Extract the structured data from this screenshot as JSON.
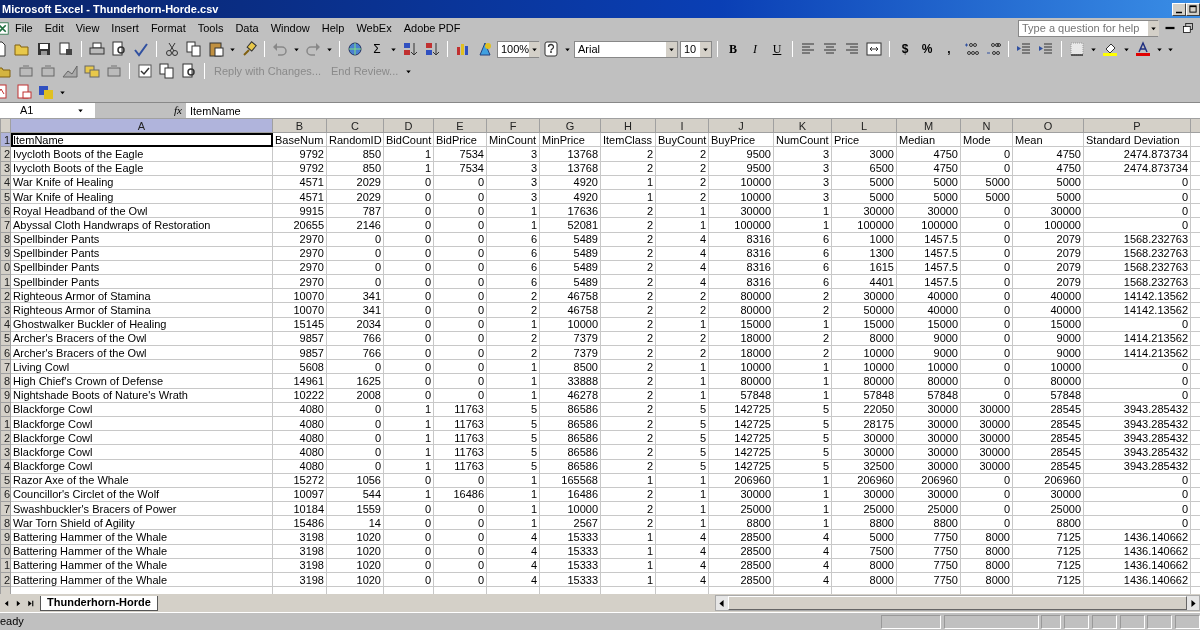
{
  "window": {
    "title": "Microsoft Excel - Thunderhorn-Horde.csv"
  },
  "menu": [
    {
      "label": "File"
    },
    {
      "label": "Edit"
    },
    {
      "label": "View"
    },
    {
      "label": "Insert"
    },
    {
      "label": "Format"
    },
    {
      "label": "Tools"
    },
    {
      "label": "Data"
    },
    {
      "label": "Window"
    },
    {
      "label": "Help"
    },
    {
      "label": "WebEx"
    },
    {
      "label": "Adobe PDF"
    }
  ],
  "help_box": {
    "placeholder": "Type a question for help"
  },
  "toolbar": {
    "sum": "Σ",
    "zoom": "100%",
    "font": "Arial",
    "font_size": "10",
    "format_buttons": [
      "B",
      "I",
      "U"
    ],
    "number_buttons": [
      "$",
      "%",
      ","
    ]
  },
  "review_toolbar": {
    "reply": "Reply with Changes...",
    "end": "End Review..."
  },
  "formula_bar": {
    "name_box": "A1",
    "fx": "fx",
    "formula": "ItemName"
  },
  "columns": [
    {
      "label": "A",
      "selected": true
    },
    {
      "label": "B",
      "selected": false
    },
    {
      "label": "C",
      "selected": false
    },
    {
      "label": "D",
      "selected": false
    },
    {
      "label": "E",
      "selected": false
    },
    {
      "label": "F",
      "selected": false
    },
    {
      "label": "G",
      "selected": false
    },
    {
      "label": "H",
      "selected": false
    },
    {
      "label": "I",
      "selected": false
    },
    {
      "label": "J",
      "selected": false
    },
    {
      "label": "K",
      "selected": false
    },
    {
      "label": "L",
      "selected": false
    },
    {
      "label": "M",
      "selected": false
    },
    {
      "label": "N",
      "selected": false
    },
    {
      "label": "O",
      "selected": false
    },
    {
      "label": "P",
      "selected": false
    }
  ],
  "rows": [
    {
      "header": "1",
      "kind": "labels",
      "selected": true,
      "cells": [
        "ItemName",
        "BaseNum",
        "RandomID",
        "BidCount",
        "BidPrice",
        "MinCount",
        "MinPrice",
        "ItemClass",
        "BuyCount",
        "BuyPrice",
        "NumCount",
        "Price",
        "Median",
        "Mode",
        "Mean",
        "Standard Deviation"
      ]
    },
    {
      "header": "2",
      "kind": "values",
      "selected": false,
      "cells": [
        "Ivycloth Boots of the Eagle",
        "9792",
        "850",
        "1",
        "7534",
        "3",
        "13768",
        "2",
        "2",
        "9500",
        "3",
        "3000",
        "4750",
        "0",
        "4750",
        "2474.873734"
      ]
    },
    {
      "header": "3",
      "kind": "values",
      "selected": false,
      "cells": [
        "Ivycloth Boots of the Eagle",
        "9792",
        "850",
        "1",
        "7534",
        "3",
        "13768",
        "2",
        "2",
        "9500",
        "3",
        "6500",
        "4750",
        "0",
        "4750",
        "2474.873734"
      ]
    },
    {
      "header": "4",
      "kind": "values",
      "selected": false,
      "cells": [
        "War Knife of Healing",
        "4571",
        "2029",
        "0",
        "0",
        "3",
        "4920",
        "1",
        "2",
        "10000",
        "3",
        "5000",
        "5000",
        "5000",
        "5000",
        "0"
      ]
    },
    {
      "header": "5",
      "kind": "values",
      "selected": false,
      "cells": [
        "War Knife of Healing",
        "4571",
        "2029",
        "0",
        "0",
        "3",
        "4920",
        "1",
        "2",
        "10000",
        "3",
        "5000",
        "5000",
        "5000",
        "5000",
        "0"
      ]
    },
    {
      "header": "6",
      "kind": "values",
      "selected": false,
      "cells": [
        "Royal Headband of the Owl",
        "9915",
        "787",
        "0",
        "0",
        "1",
        "17636",
        "2",
        "1",
        "30000",
        "1",
        "30000",
        "30000",
        "0",
        "30000",
        "0"
      ]
    },
    {
      "header": "7",
      "kind": "values",
      "selected": false,
      "cells": [
        "Abyssal Cloth Handwraps of Restoration",
        "20655",
        "2146",
        "0",
        "0",
        "1",
        "52081",
        "2",
        "1",
        "100000",
        "1",
        "100000",
        "100000",
        "0",
        "100000",
        "0"
      ]
    },
    {
      "header": "8",
      "kind": "values",
      "selected": false,
      "cells": [
        "Spellbinder Pants",
        "2970",
        "0",
        "0",
        "0",
        "6",
        "5489",
        "2",
        "4",
        "8316",
        "6",
        "1000",
        "1457.5",
        "0",
        "2079",
        "1568.232763"
      ]
    },
    {
      "header": "9",
      "kind": "values",
      "selected": false,
      "cells": [
        "Spellbinder Pants",
        "2970",
        "0",
        "0",
        "0",
        "6",
        "5489",
        "2",
        "4",
        "8316",
        "6",
        "1300",
        "1457.5",
        "0",
        "2079",
        "1568.232763"
      ]
    },
    {
      "header": "0",
      "kind": "values",
      "selected": false,
      "cells": [
        "Spellbinder Pants",
        "2970",
        "0",
        "0",
        "0",
        "6",
        "5489",
        "2",
        "4",
        "8316",
        "6",
        "1615",
        "1457.5",
        "0",
        "2079",
        "1568.232763"
      ]
    },
    {
      "header": "1",
      "kind": "values",
      "selected": false,
      "cells": [
        "Spellbinder Pants",
        "2970",
        "0",
        "0",
        "0",
        "6",
        "5489",
        "2",
        "4",
        "8316",
        "6",
        "4401",
        "1457.5",
        "0",
        "2079",
        "1568.232763"
      ]
    },
    {
      "header": "2",
      "kind": "values",
      "selected": false,
      "cells": [
        "Righteous Armor of Stamina",
        "10070",
        "341",
        "0",
        "0",
        "2",
        "46758",
        "2",
        "2",
        "80000",
        "2",
        "30000",
        "40000",
        "0",
        "40000",
        "14142.13562"
      ]
    },
    {
      "header": "3",
      "kind": "values",
      "selected": false,
      "cells": [
        "Righteous Armor of Stamina",
        "10070",
        "341",
        "0",
        "0",
        "2",
        "46758",
        "2",
        "2",
        "80000",
        "2",
        "50000",
        "40000",
        "0",
        "40000",
        "14142.13562"
      ]
    },
    {
      "header": "4",
      "kind": "values",
      "selected": false,
      "cells": [
        "Ghostwalker Buckler of Healing",
        "15145",
        "2034",
        "0",
        "0",
        "1",
        "10000",
        "2",
        "1",
        "15000",
        "1",
        "15000",
        "15000",
        "0",
        "15000",
        "0"
      ]
    },
    {
      "header": "5",
      "kind": "values",
      "selected": false,
      "cells": [
        "Archer's Bracers of the Owl",
        "9857",
        "766",
        "0",
        "0",
        "2",
        "7379",
        "2",
        "2",
        "18000",
        "2",
        "8000",
        "9000",
        "0",
        "9000",
        "1414.213562"
      ]
    },
    {
      "header": "6",
      "kind": "values",
      "selected": false,
      "cells": [
        "Archer's Bracers of the Owl",
        "9857",
        "766",
        "0",
        "0",
        "2",
        "7379",
        "2",
        "2",
        "18000",
        "2",
        "10000",
        "9000",
        "0",
        "9000",
        "1414.213562"
      ]
    },
    {
      "header": "7",
      "kind": "values",
      "selected": false,
      "cells": [
        "Living Cowl",
        "5608",
        "0",
        "0",
        "0",
        "1",
        "8500",
        "2",
        "1",
        "10000",
        "1",
        "10000",
        "10000",
        "0",
        "10000",
        "0"
      ]
    },
    {
      "header": "8",
      "kind": "values",
      "selected": false,
      "cells": [
        "High Chief's Crown of Defense",
        "14961",
        "1625",
        "0",
        "0",
        "1",
        "33888",
        "2",
        "1",
        "80000",
        "1",
        "80000",
        "80000",
        "0",
        "80000",
        "0"
      ]
    },
    {
      "header": "9",
      "kind": "values",
      "selected": false,
      "cells": [
        "Nightshade Boots of Nature's Wrath",
        "10222",
        "2008",
        "0",
        "0",
        "1",
        "46278",
        "2",
        "1",
        "57848",
        "1",
        "57848",
        "57848",
        "0",
        "57848",
        "0"
      ]
    },
    {
      "header": "0",
      "kind": "values",
      "selected": false,
      "cells": [
        "Blackforge Cowl",
        "4080",
        "0",
        "1",
        "11763",
        "5",
        "86586",
        "2",
        "5",
        "142725",
        "5",
        "22050",
        "30000",
        "30000",
        "28545",
        "3943.285432"
      ]
    },
    {
      "header": "1",
      "kind": "values",
      "selected": false,
      "cells": [
        "Blackforge Cowl",
        "4080",
        "0",
        "1",
        "11763",
        "5",
        "86586",
        "2",
        "5",
        "142725",
        "5",
        "28175",
        "30000",
        "30000",
        "28545",
        "3943.285432"
      ]
    },
    {
      "header": "2",
      "kind": "values",
      "selected": false,
      "cells": [
        "Blackforge Cowl",
        "4080",
        "0",
        "1",
        "11763",
        "5",
        "86586",
        "2",
        "5",
        "142725",
        "5",
        "30000",
        "30000",
        "30000",
        "28545",
        "3943.285432"
      ]
    },
    {
      "header": "3",
      "kind": "values",
      "selected": false,
      "cells": [
        "Blackforge Cowl",
        "4080",
        "0",
        "1",
        "11763",
        "5",
        "86586",
        "2",
        "5",
        "142725",
        "5",
        "30000",
        "30000",
        "30000",
        "28545",
        "3943.285432"
      ]
    },
    {
      "header": "4",
      "kind": "values",
      "selected": false,
      "cells": [
        "Blackforge Cowl",
        "4080",
        "0",
        "1",
        "11763",
        "5",
        "86586",
        "2",
        "5",
        "142725",
        "5",
        "32500",
        "30000",
        "30000",
        "28545",
        "3943.285432"
      ]
    },
    {
      "header": "5",
      "kind": "values",
      "selected": false,
      "cells": [
        "Razor Axe of the Whale",
        "15272",
        "1056",
        "0",
        "0",
        "1",
        "165568",
        "1",
        "1",
        "206960",
        "1",
        "206960",
        "206960",
        "0",
        "206960",
        "0"
      ]
    },
    {
      "header": "6",
      "kind": "values",
      "selected": false,
      "cells": [
        "Councillor's Circlet of the Wolf",
        "10097",
        "544",
        "1",
        "16486",
        "1",
        "16486",
        "2",
        "1",
        "30000",
        "1",
        "30000",
        "30000",
        "0",
        "30000",
        "0"
      ]
    },
    {
      "header": "7",
      "kind": "values",
      "selected": false,
      "cells": [
        "Swashbuckler's Bracers of Power",
        "10184",
        "1559",
        "0",
        "0",
        "1",
        "10000",
        "2",
        "1",
        "25000",
        "1",
        "25000",
        "25000",
        "0",
        "25000",
        "0"
      ]
    },
    {
      "header": "8",
      "kind": "values",
      "selected": false,
      "cells": [
        "War Torn Shield of Agility",
        "15486",
        "14",
        "0",
        "0",
        "1",
        "2567",
        "2",
        "1",
        "8800",
        "1",
        "8800",
        "8800",
        "0",
        "8800",
        "0"
      ]
    },
    {
      "header": "9",
      "kind": "values",
      "selected": false,
      "cells": [
        "Battering Hammer of the Whale",
        "3198",
        "1020",
        "0",
        "0",
        "4",
        "15333",
        "1",
        "4",
        "28500",
        "4",
        "5000",
        "7750",
        "8000",
        "7125",
        "1436.140662"
      ]
    },
    {
      "header": "0",
      "kind": "values",
      "selected": false,
      "cells": [
        "Battering Hammer of the Whale",
        "3198",
        "1020",
        "0",
        "0",
        "4",
        "15333",
        "1",
        "4",
        "28500",
        "4",
        "7500",
        "7750",
        "8000",
        "7125",
        "1436.140662"
      ]
    },
    {
      "header": "1",
      "kind": "values",
      "selected": false,
      "cells": [
        "Battering Hammer of the Whale",
        "3198",
        "1020",
        "0",
        "0",
        "4",
        "15333",
        "1",
        "4",
        "28500",
        "4",
        "8000",
        "7750",
        "8000",
        "7125",
        "1436.140662"
      ]
    },
    {
      "header": "2",
      "kind": "values",
      "selected": false,
      "cells": [
        "Battering Hammer of the Whale",
        "3198",
        "1020",
        "0",
        "0",
        "4",
        "15333",
        "1",
        "4",
        "28500",
        "4",
        "8000",
        "7750",
        "8000",
        "7125",
        "1436.140662"
      ]
    }
  ],
  "sheet_tabs": [
    {
      "label": "Thunderhorn-Horde",
      "selected": true
    }
  ],
  "status_bar": {
    "text": "eady"
  }
}
